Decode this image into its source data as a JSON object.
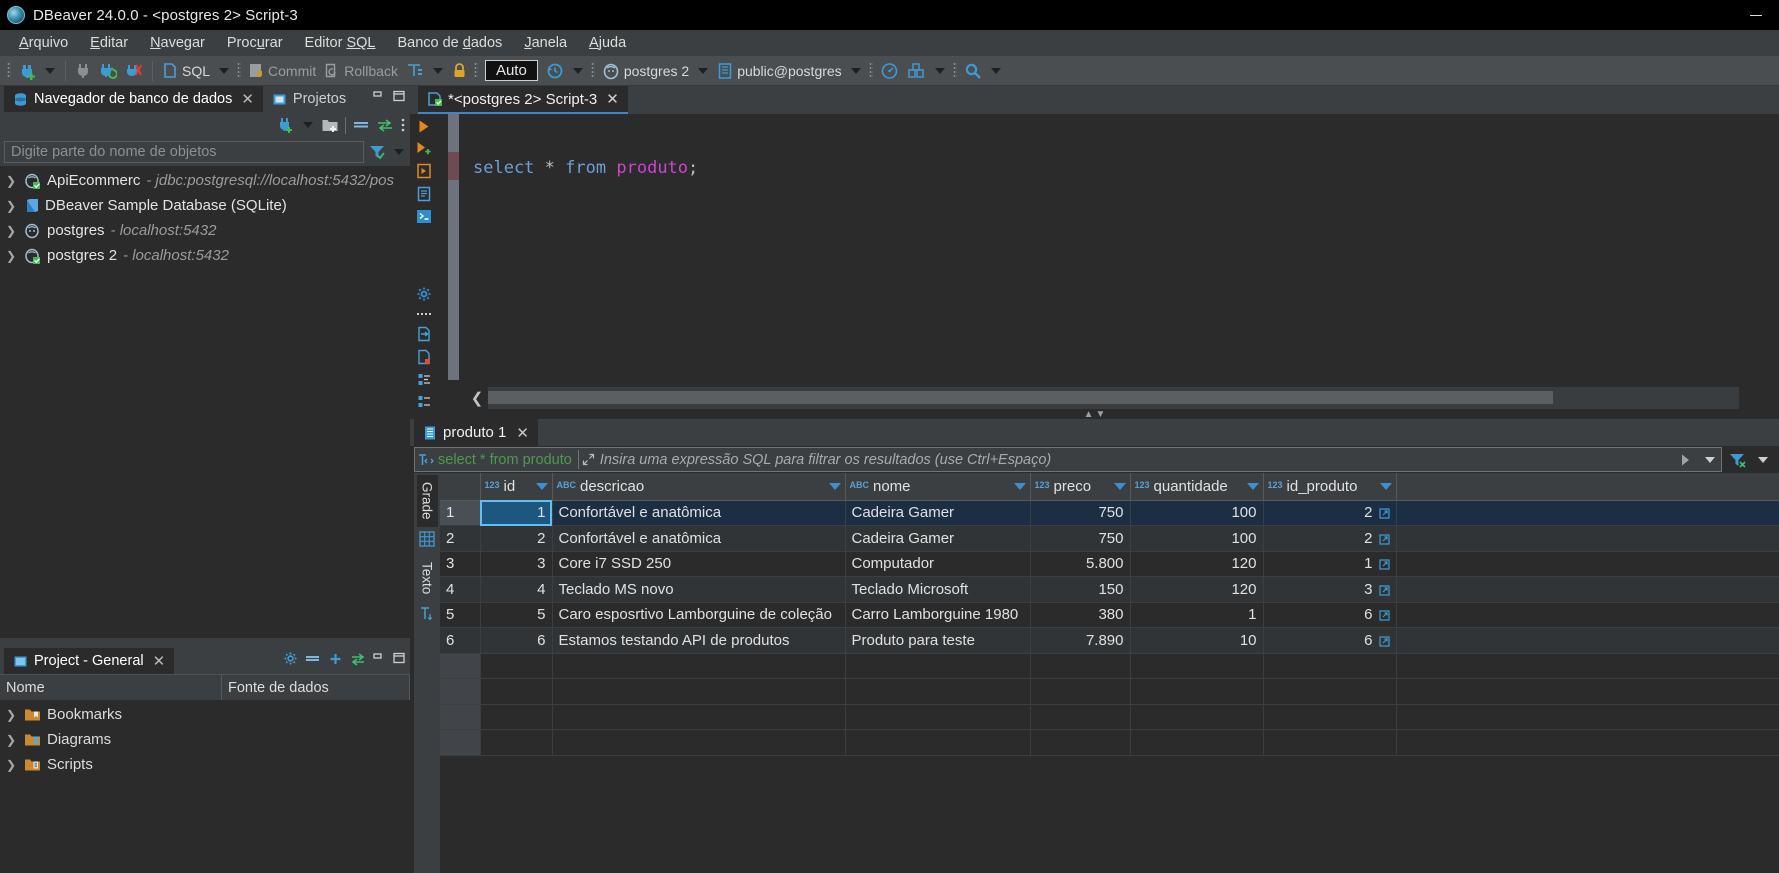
{
  "window": {
    "title": "DBeaver 24.0.0 - <postgres 2> Script-3",
    "minimize_label": "Minimizar"
  },
  "menubar": [
    {
      "label": "Arquivo",
      "mnemonic": "A"
    },
    {
      "label": "Editar",
      "mnemonic": "E"
    },
    {
      "label": "Navegar",
      "mnemonic": "N"
    },
    {
      "label": "Procurar",
      "mnemonic": "u"
    },
    {
      "label": "Editor SQL",
      "mnemonic": "SQL"
    },
    {
      "label": "Banco de dados",
      "mnemonic": "d"
    },
    {
      "label": "Janela",
      "mnemonic": "J"
    },
    {
      "label": "Ajuda",
      "mnemonic": "A"
    }
  ],
  "toolbar": {
    "sql_label": "SQL",
    "commit_label": "Commit",
    "rollback_label": "Rollback",
    "auto_label": "Auto",
    "connection_label": "postgres 2",
    "schema_label": "public@postgres"
  },
  "left_panel": {
    "tabs": [
      {
        "label": "Navegador de banco de dados",
        "active": true,
        "closable": true
      },
      {
        "label": "Projetos",
        "active": false,
        "closable": false
      }
    ],
    "search_placeholder": "Digite parte do nome de objetos",
    "tree": [
      {
        "label": "ApiEcommerc",
        "detail": "- jdbc:postgresql://localhost:5432/pos",
        "icon": "postgres-db-icon"
      },
      {
        "label": "DBeaver Sample Database (SQLite)",
        "detail": "",
        "icon": "sqlite-db-icon"
      },
      {
        "label": "postgres",
        "detail": "- localhost:5432",
        "icon": "postgres-db-icon"
      },
      {
        "label": "postgres 2",
        "detail": "- localhost:5432",
        "icon": "postgres-db-icon"
      }
    ]
  },
  "project_panel": {
    "tab_label": "Project - General",
    "columns": [
      "Nome",
      "Fonte de dados"
    ],
    "rows": [
      {
        "label": "Bookmarks",
        "icon": "bookmarks-folder-icon"
      },
      {
        "label": "Diagrams",
        "icon": "diagrams-folder-icon"
      },
      {
        "label": "Scripts",
        "icon": "scripts-folder-icon"
      }
    ]
  },
  "editor": {
    "tab_label": "*<postgres 2> Script-3",
    "code": {
      "keyword1": "select",
      "star": "*",
      "keyword2": "from",
      "table": "produto",
      "semicolon": ";"
    }
  },
  "results": {
    "tab_label": "produto 1",
    "filter_query": "select * from produto",
    "filter_placeholder": "Insira uma expressão SQL para filtrar os resultados (use Ctrl+Espaço)",
    "side_tabs": [
      "Grade",
      "Texto"
    ],
    "columns": [
      {
        "name": "id",
        "type": "123",
        "key": true
      },
      {
        "name": "descricao",
        "type": "ABC",
        "key": false
      },
      {
        "name": "nome",
        "type": "ABC",
        "key": false
      },
      {
        "name": "preco",
        "type": "123",
        "key": false
      },
      {
        "name": "quantidade",
        "type": "123",
        "key": false
      },
      {
        "name": "id_produto",
        "type": "123",
        "key": false
      }
    ],
    "rows": [
      {
        "n": "1",
        "id": "1",
        "descricao": "Confortável e anatômica",
        "nome": "Cadeira Gamer",
        "preco": "750",
        "quantidade": "100",
        "id_produto": "2"
      },
      {
        "n": "2",
        "id": "2",
        "descricao": "Confortável e anatômica",
        "nome": "Cadeira Gamer",
        "preco": "750",
        "quantidade": "100",
        "id_produto": "2"
      },
      {
        "n": "3",
        "id": "3",
        "descricao": "Core i7 SSD 250",
        "nome": "Computador",
        "preco": "5.800",
        "quantidade": "120",
        "id_produto": "1"
      },
      {
        "n": "4",
        "id": "4",
        "descricao": "Teclado MS novo",
        "nome": "Teclado Microsoft",
        "preco": "150",
        "quantidade": "120",
        "id_produto": "3"
      },
      {
        "n": "5",
        "id": "5",
        "descricao": "Caro esposrtivo Lamborguine de coleção",
        "nome": "Carro Lamborguine 1980",
        "preco": "380",
        "quantidade": "1",
        "id_produto": "6"
      },
      {
        "n": "6",
        "id": "6",
        "descricao": "Estamos testando API de produtos",
        "nome": "Produto para teste",
        "preco": "7.890",
        "quantidade": "10",
        "id_produto": "6"
      }
    ]
  },
  "colors": {
    "accent": "#3d87c9",
    "keyword": "#6a9fd4",
    "table_name": "#cc44cc",
    "filter_query": "#4e9a4e",
    "selection": "#1d567f",
    "chrome": "#3c3f41",
    "background": "#2b2b2b"
  }
}
